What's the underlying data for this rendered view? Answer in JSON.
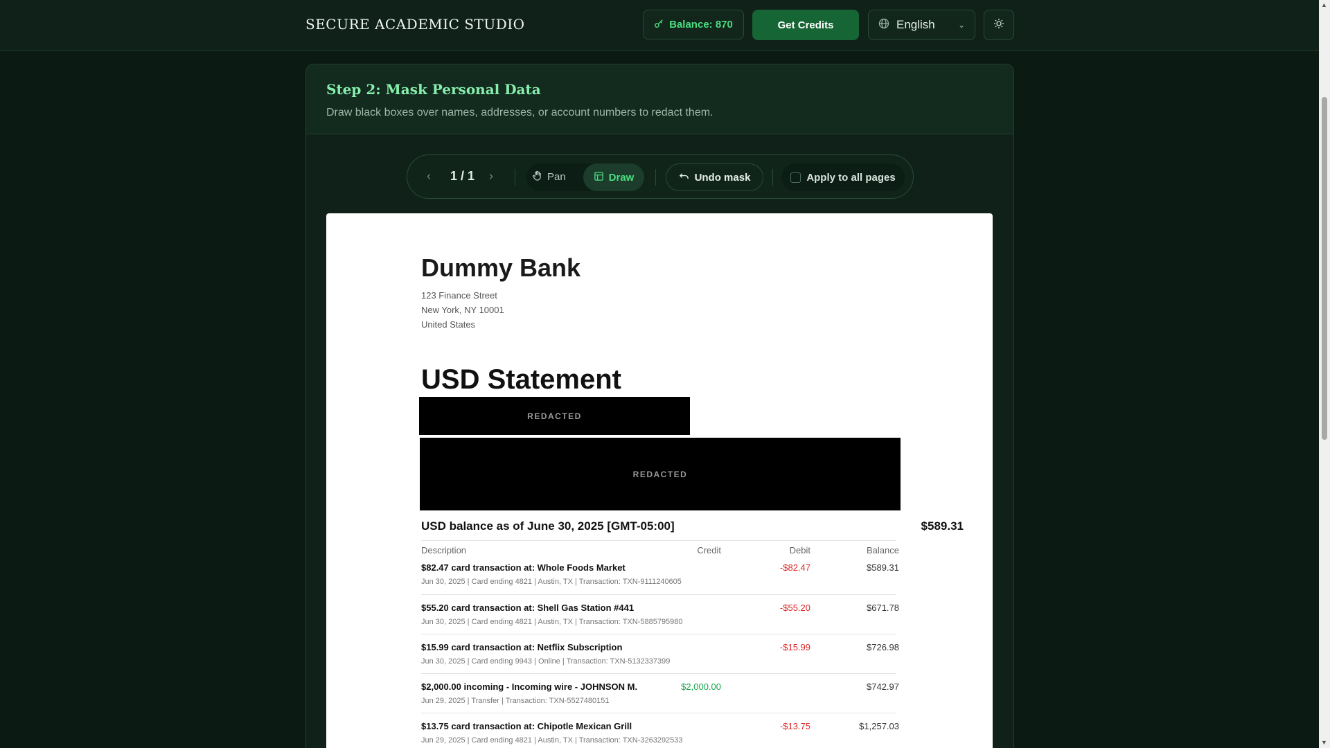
{
  "header": {
    "brand": "SECURE ACADEMIC STUDIO",
    "balance_label": "Balance: 870",
    "get_credits_label": "Get Credits",
    "language": "English"
  },
  "step": {
    "title": "Step 2: Mask Personal Data",
    "description": "Draw black boxes over names, addresses, or account numbers to redact them."
  },
  "toolbar": {
    "page_indicator": "1 / 1",
    "pan_label": "Pan",
    "draw_label": "Draw",
    "undo_label": "Undo mask",
    "apply_all_label": "Apply to all pages",
    "active_tool": "Draw"
  },
  "document": {
    "bank_name": "Dummy Bank",
    "address": [
      "123 Finance Street",
      "New York, NY 10001",
      "United States"
    ],
    "statement_title": "USD Statement",
    "redaction_label": "REDACTED",
    "balance_label": "USD balance as of June 30, 2025 [GMT-05:00]",
    "balance_value": "$589.31",
    "columns": [
      "Description",
      "Credit",
      "Debit",
      "Balance"
    ],
    "transactions": [
      {
        "desc": "$82.47 card transaction at: Whole Foods Market",
        "meta": "Jun 30, 2025  |  Card ending 4821  |  Austin, TX  |  Transaction: TXN-9111240605",
        "credit": "",
        "debit": "-$82.47",
        "balance": "$589.31"
      },
      {
        "desc": "$55.20 card transaction at: Shell Gas Station #441",
        "meta": "Jun 30, 2025  |  Card ending 4821  |  Austin, TX  |  Transaction: TXN-5885795980",
        "credit": "",
        "debit": "-$55.20",
        "balance": "$671.78"
      },
      {
        "desc": "$15.99 card transaction at: Netflix Subscription",
        "meta": "Jun 30, 2025  |  Card ending 9943  |  Online  |  Transaction: TXN-5132337399",
        "credit": "",
        "debit": "-$15.99",
        "balance": "$726.98"
      },
      {
        "desc": "$2,000.00 incoming - Incoming wire - JOHNSON M.",
        "meta": "Jun 29, 2025  |  Transfer  |  Transaction: TXN-5527480151",
        "credit": "$2,000.00",
        "debit": "",
        "balance": "$742.97"
      },
      {
        "desc": "$13.75 card transaction at: Chipotle Mexican Grill",
        "meta": "Jun 29, 2025  |  Card ending 4821  |  Austin, TX  |  Transaction: TXN-3263292533",
        "credit": "",
        "debit": "-$13.75",
        "balance": "$1,257.03"
      }
    ]
  }
}
